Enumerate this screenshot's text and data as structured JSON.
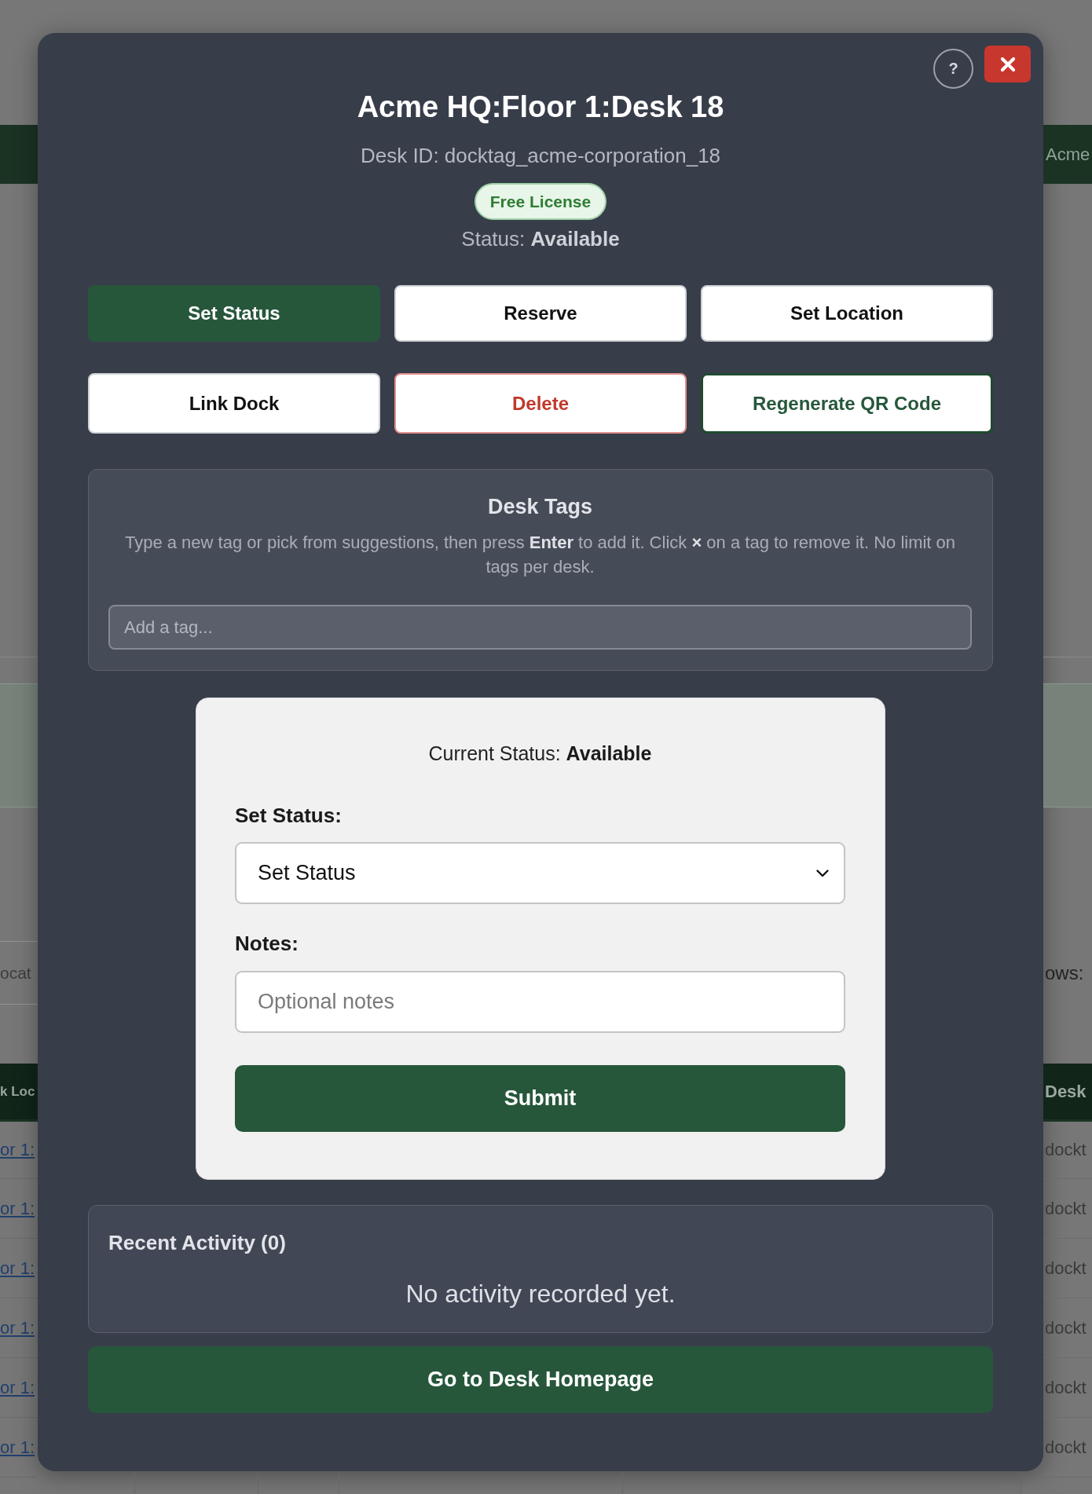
{
  "background_page": {
    "header_bar": {
      "text": "Acme"
    },
    "filter_field": {
      "value": "ocat"
    },
    "rows_label": "ows:",
    "table": {
      "columns": [
        "k Loc",
        "Desk"
      ],
      "rows": [
        {
          "cells": [
            "or 1:",
            "dockt"
          ]
        },
        {
          "cells": [
            "or 1:",
            "dockt"
          ]
        },
        {
          "cells": [
            "or 1:",
            "dockt"
          ]
        },
        {
          "cells": [
            "or 1:",
            "dockt"
          ]
        },
        {
          "cells": [
            "or 1:",
            "dockt"
          ]
        },
        {
          "cells": [
            "or 1:",
            "dockt"
          ]
        }
      ]
    }
  },
  "dialog": {
    "help_button": {
      "label": "?"
    },
    "title": "Acme HQ:Floor 1:Desk 18",
    "desk_id": "Desk ID: docktag_acme-corporation_18",
    "license_badge": "Free License",
    "status_line": "Status: **Available**",
    "actions": [
      {
        "label": "Set Status",
        "kind": "primary"
      },
      {
        "label": "Reserve",
        "kind": "secondary"
      },
      {
        "label": "Set Location",
        "kind": "secondary"
      },
      {
        "label": "Link Dock",
        "kind": "secondary"
      },
      {
        "label": "Delete",
        "kind": "danger"
      },
      {
        "label": "Regenerate QR Code",
        "kind": "success"
      }
    ],
    "tags_panel": {
      "heading": "Desk Tags",
      "help": "Type a new tag or pick from suggestions, then press **Enter** to add it. Click **×** on a tag to remove it. No limit on tags per desk.",
      "input": {
        "placeholder": "Add a tag..."
      }
    },
    "status_form": {
      "current_status": "Current Status: **Available**",
      "status_label": "Set Status:",
      "status_select": {
        "value": "Set Status"
      },
      "notes_label": "Notes:",
      "notes_input": {
        "placeholder": "Optional notes"
      },
      "submit": "Submit"
    },
    "activity": {
      "heading": "Recent Activity (0)",
      "empty_text": "No activity recorded yet."
    },
    "homepage_button": "Go to Desk Homepage"
  }
}
